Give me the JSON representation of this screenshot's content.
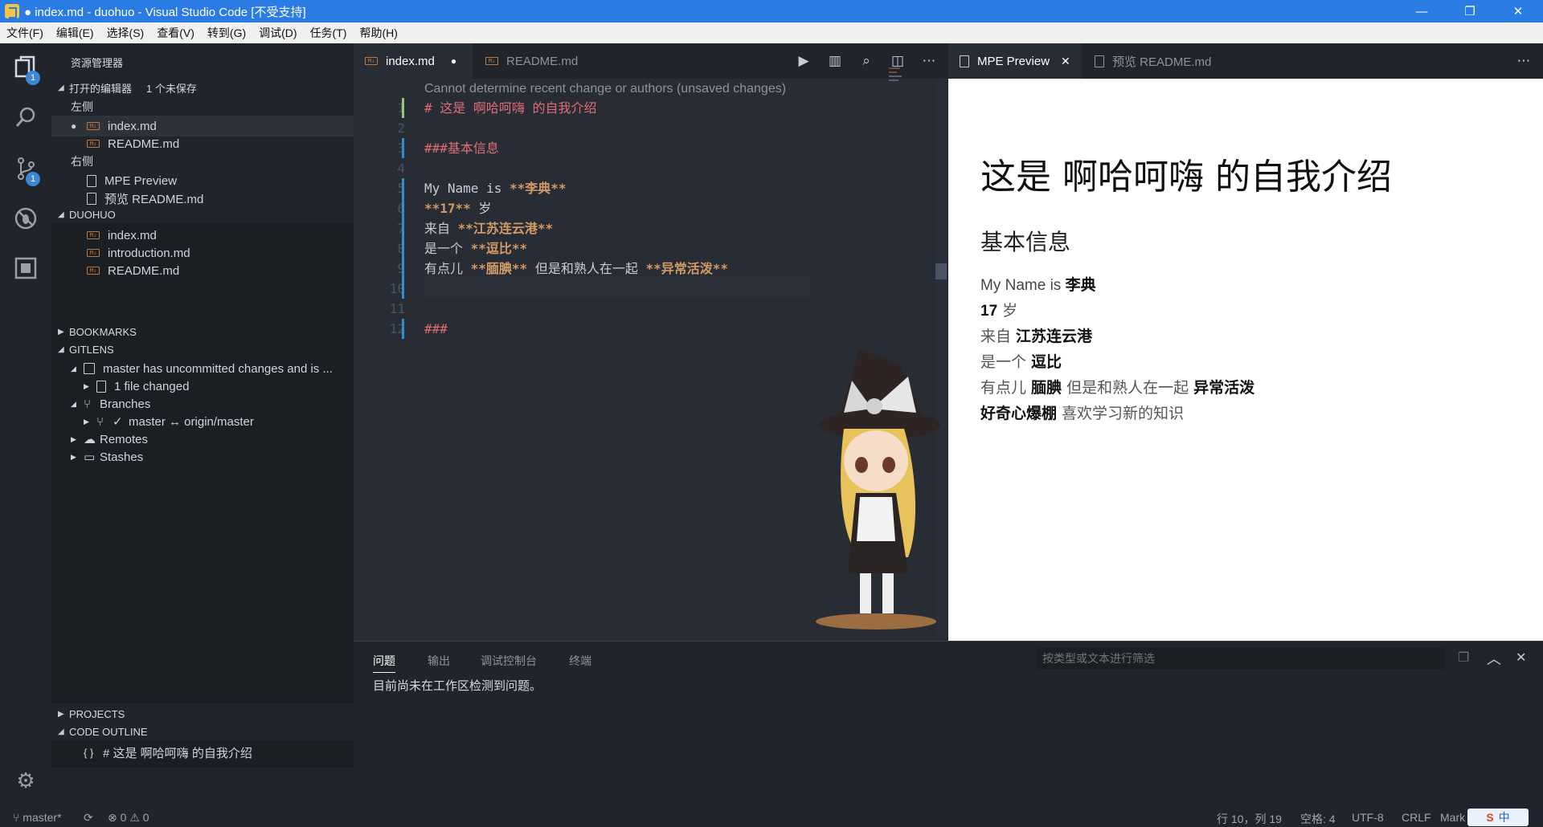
{
  "window": {
    "title": "● index.md - duohuo - Visual Studio Code [不受支持]",
    "minimize": "—",
    "restore": "❐",
    "close": "✕"
  },
  "menu": [
    "文件(F)",
    "编辑(E)",
    "选择(S)",
    "查看(V)",
    "转到(G)",
    "调试(D)",
    "任务(T)",
    "帮助(H)"
  ],
  "activity": {
    "explorer_badge": "1",
    "scm_badge": "1"
  },
  "sidebar": {
    "title": "资源管理器",
    "open_editors": {
      "header": "打开的编辑器",
      "unsaved": "1 个未保存",
      "left_group": "左侧",
      "left_files": [
        "index.md",
        "README.md"
      ],
      "right_group": "右侧",
      "right_files": [
        "MPE Preview",
        "预览 README.md"
      ]
    },
    "workspace": {
      "header": "DUOHUO",
      "files": [
        "index.md",
        "introduction.md",
        "README.md"
      ]
    },
    "bookmarks": "BOOKMARKS",
    "gitlens": {
      "header": "GITLENS",
      "repo": "master has uncommitted changes and is ...",
      "changed": "1 file changed",
      "branches": "Branches",
      "branch_item": "master ↔ origin/master",
      "remotes": "Remotes",
      "stashes": "Stashes"
    },
    "projects": "PROJECTS",
    "code_outline": {
      "header": "CODE OUTLINE",
      "item_icon": "{ }",
      "item": "# 这是 啊哈呵嗨 的自我介绍"
    }
  },
  "editor": {
    "tabs": [
      {
        "label": "index.md",
        "dirty": "●"
      },
      {
        "label": "README.md"
      }
    ],
    "codelens": "Cannot determine recent change or authors (unsaved changes)",
    "lines": [
      {
        "n": "1",
        "parts": [
          {
            "t": "# 这是 啊哈呵嗨 的自我介绍",
            "c": "hdr"
          }
        ]
      },
      {
        "n": "2",
        "parts": []
      },
      {
        "n": "3",
        "parts": [
          {
            "t": "###基本信息",
            "c": "hdr"
          }
        ]
      },
      {
        "n": "4",
        "parts": []
      },
      {
        "n": "5",
        "parts": [
          {
            "t": "My Name is ",
            "c": ""
          },
          {
            "t": "**李典**",
            "c": "bold"
          }
        ]
      },
      {
        "n": "6",
        "parts": [
          {
            "t": "**17**",
            "c": "bold"
          },
          {
            "t": " 岁",
            "c": ""
          }
        ]
      },
      {
        "n": "7",
        "parts": [
          {
            "t": "来自 ",
            "c": ""
          },
          {
            "t": "**江苏连云港**",
            "c": "bold"
          }
        ]
      },
      {
        "n": "8",
        "parts": [
          {
            "t": "是一个 ",
            "c": ""
          },
          {
            "t": "**逗比**",
            "c": "bold"
          }
        ]
      },
      {
        "n": "9",
        "parts": [
          {
            "t": "有点儿 ",
            "c": ""
          },
          {
            "t": "**腼腆**",
            "c": "bold"
          },
          {
            "t": " 但是和熟人在一起 ",
            "c": ""
          },
          {
            "t": "**异常活泼**",
            "c": "bold"
          }
        ]
      },
      {
        "n": "10",
        "parts": [
          {
            "t": "**好奇心爆棚**",
            "c": "bold"
          },
          {
            "t": " 喜欢学习新的知识",
            "c": ""
          }
        ]
      },
      {
        "n": "11",
        "parts": []
      },
      {
        "n": "12",
        "parts": [
          {
            "t": "###",
            "c": "hdr"
          }
        ]
      }
    ]
  },
  "preview": {
    "tabs": [
      {
        "label": "MPE Preview",
        "close": "✕"
      },
      {
        "label": "预览 README.md"
      }
    ],
    "h1": "这是 啊哈呵嗨 的自我介绍",
    "h3": "基本信息",
    "p1_plain": "My Name is ",
    "p1_bold": "李典",
    "p2_bold": "17",
    "p2_plain": " 岁",
    "p3_plain": "来自 ",
    "p3_bold": "江苏连云港",
    "p4_plain": "是一个 ",
    "p4_bold": "逗比",
    "p5_plain1": "有点儿 ",
    "p5_bold1": "腼腆",
    "p5_plain2": " 但是和熟人在一起 ",
    "p5_bold2": "异常活泼",
    "p6_bold": "好奇心爆棚",
    "p6_plain": " 喜欢学习新的知识"
  },
  "panel": {
    "tabs": [
      "问题",
      "输出",
      "调试控制台",
      "终端"
    ],
    "filter_placeholder": "按类型或文本进行筛选",
    "message": "目前尚未在工作区检测到问题。"
  },
  "status": {
    "branch": "master*",
    "errors": "0",
    "warnings": "0",
    "position": "行 10，列 19",
    "spaces": "空格: 4",
    "encoding": "UTF-8",
    "eol": "CRLF",
    "language": "Mark",
    "ime": "中"
  },
  "colors": {
    "titlebar": "#2a7be4",
    "header_red": "#e06c75",
    "bold_orange": "#d19a66",
    "badge_blue": "#3c87d6"
  }
}
